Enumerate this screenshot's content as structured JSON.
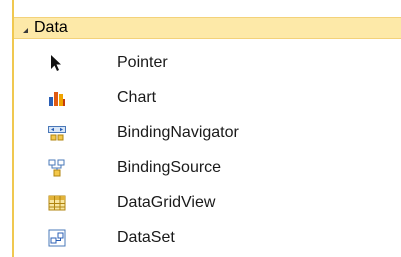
{
  "section": {
    "title": "Data",
    "expand_icon": "collapse-triangle-icon"
  },
  "items": [
    {
      "label": "Pointer",
      "icon": "pointer-arrow-icon"
    },
    {
      "label": "Chart",
      "icon": "chart-icon"
    },
    {
      "label": "BindingNavigator",
      "icon": "binding-navigator-icon"
    },
    {
      "label": "BindingSource",
      "icon": "binding-source-icon"
    },
    {
      "label": "DataGridView",
      "icon": "datagridview-icon"
    },
    {
      "label": "DataSet",
      "icon": "dataset-icon"
    }
  ],
  "colors": {
    "header_bg": "#fde9a8",
    "accent_border": "#f0c850"
  }
}
